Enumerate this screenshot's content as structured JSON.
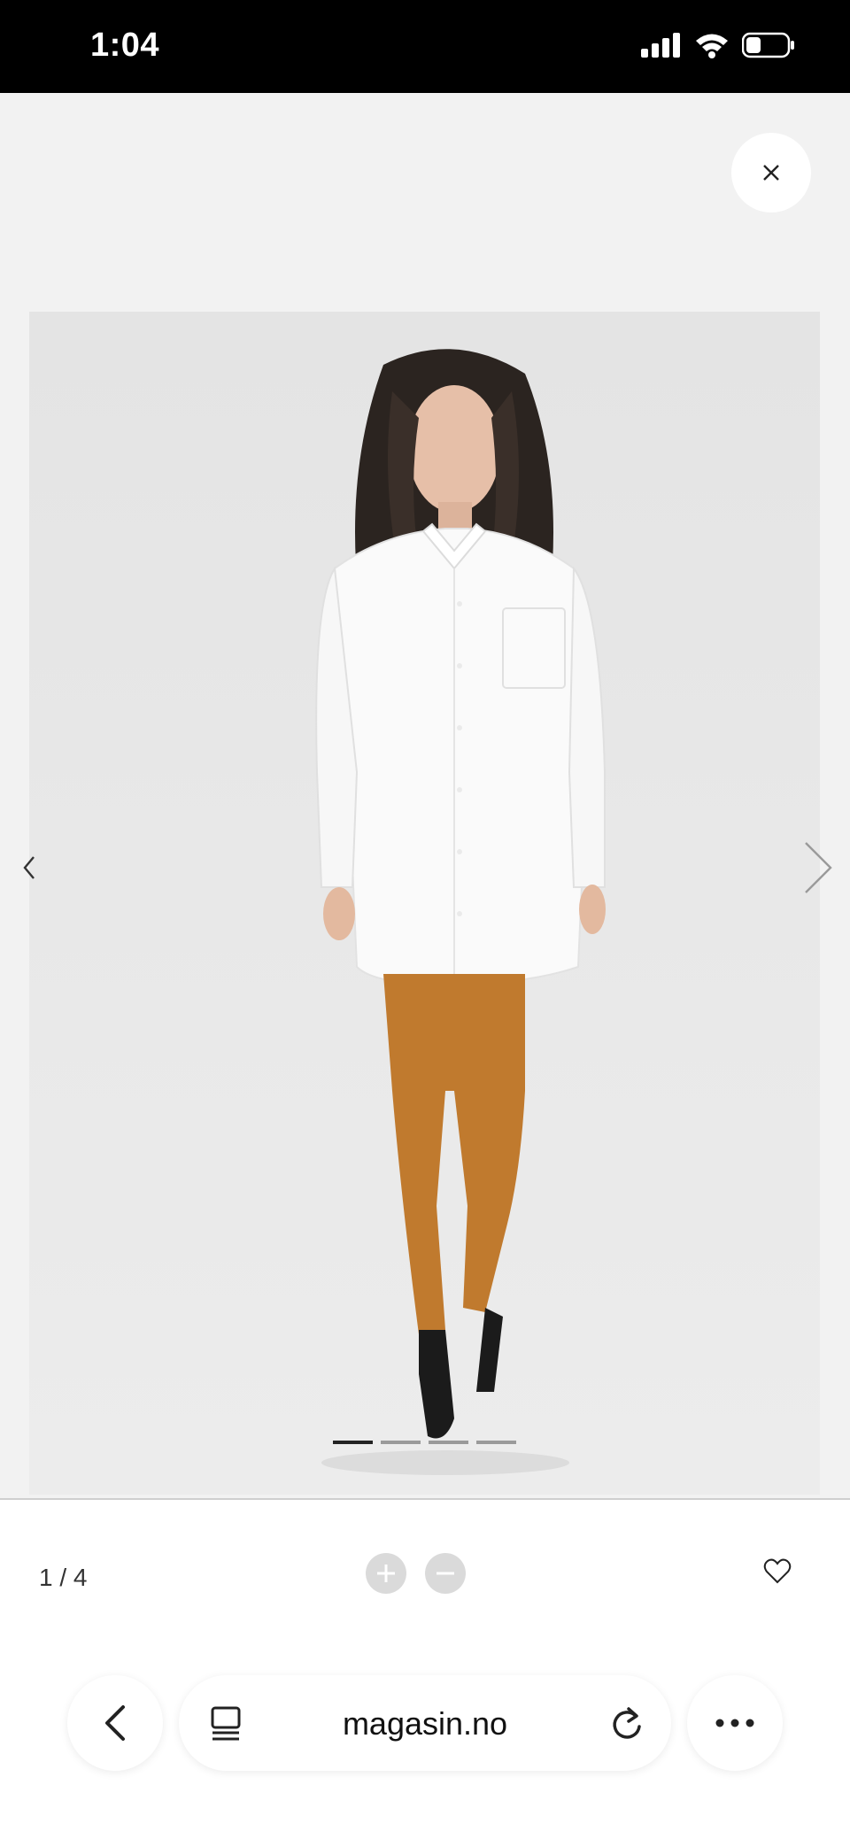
{
  "status_bar": {
    "time": "1:04"
  },
  "viewer": {
    "close_label": "×",
    "photo_description_icon": "product-photo",
    "slides_total": 4,
    "active_slide": 1
  },
  "info_bar": {
    "counter": "1 / 4"
  },
  "browser": {
    "url": "magasin.no"
  },
  "colors": {
    "status_bg": "#000000",
    "viewer_bg": "#f2f2f2",
    "active_dot": "#222222",
    "inactive_dot": "#9a9a9a"
  }
}
